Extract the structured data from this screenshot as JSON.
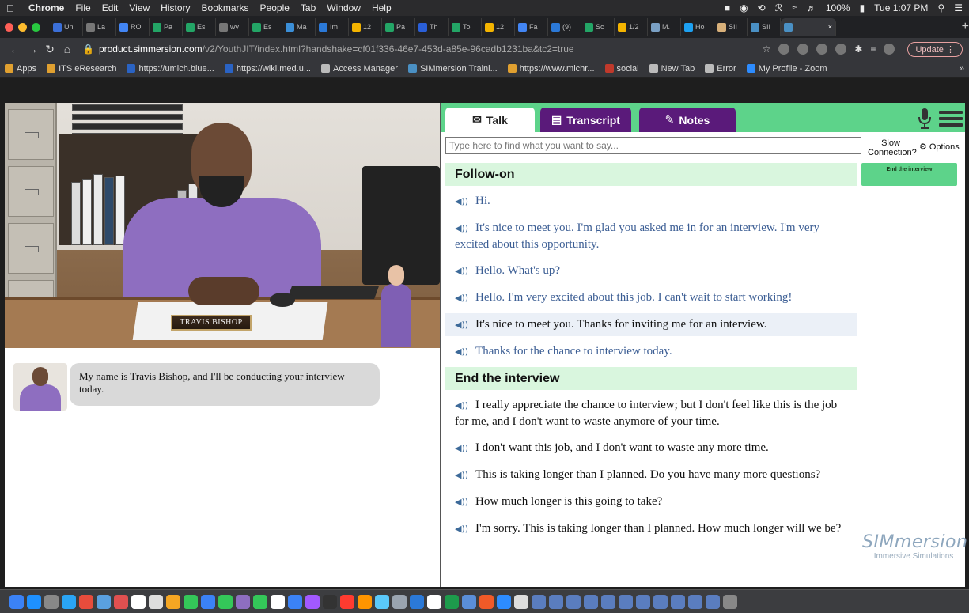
{
  "menubar": {
    "app": "Chrome",
    "items": [
      "File",
      "Edit",
      "View",
      "History",
      "Bookmarks",
      "People",
      "Tab",
      "Window",
      "Help"
    ],
    "battery": "100%",
    "clock": "Tue 1:07 PM"
  },
  "tabs": [
    {
      "label": "Un",
      "color": "#3b6fd8"
    },
    {
      "label": "La",
      "color": "#777777"
    },
    {
      "label": "RO",
      "color": "#4285f4"
    },
    {
      "label": "Pa",
      "color": "#23a566"
    },
    {
      "label": "Es",
      "color": "#23a566"
    },
    {
      "label": "wv",
      "color": "#777777"
    },
    {
      "label": "Es",
      "color": "#23a566"
    },
    {
      "label": "Ma",
      "color": "#3b8fd8"
    },
    {
      "label": "Im",
      "color": "#2b79d8"
    },
    {
      "label": "12",
      "color": "#f4b400"
    },
    {
      "label": "Pa",
      "color": "#23a566"
    },
    {
      "label": "Th",
      "color": "#2a5fd8"
    },
    {
      "label": "To",
      "color": "#23a566"
    },
    {
      "label": "12",
      "color": "#f4b400"
    },
    {
      "label": "Fa",
      "color": "#4285f4"
    },
    {
      "label": "(9)",
      "color": "#2b79d8"
    },
    {
      "label": "Sc",
      "color": "#23a566"
    },
    {
      "label": "1/2",
      "color": "#f4b400"
    },
    {
      "label": "M.",
      "color": "#7aa0c4"
    },
    {
      "label": "Ho",
      "color": "#1da1f2"
    },
    {
      "label": "SII",
      "color": "#d8b07a"
    },
    {
      "label": "SII",
      "color": "#4a90c4"
    },
    {
      "label": "",
      "color": "#4a90c4",
      "active": true
    }
  ],
  "address": {
    "host": "product.simmersion.com",
    "path": "/v2/YouthJIT/index.html?handshake=cf01f336-46e7-453d-a85e-96cadb1231ba&tc2=true",
    "update_label": "Update"
  },
  "bookmarks": [
    {
      "label": "Apps",
      "color": "#e0a030"
    },
    {
      "label": "ITS eResearch",
      "color": "#e0a030"
    },
    {
      "label": "https://umich.blue...",
      "color": "#2a63c4"
    },
    {
      "label": "https://wiki.med.u...",
      "color": "#2a63c4"
    },
    {
      "label": "Access Manager",
      "color": "#bbbbbb"
    },
    {
      "label": "SIMmersion Traini...",
      "color": "#4a90c4"
    },
    {
      "label": "https://www.michr...",
      "color": "#e0a030"
    },
    {
      "label": "social",
      "color": "#c0392b"
    },
    {
      "label": "New Tab",
      "color": "#bbbbbb"
    },
    {
      "label": "Error",
      "color": "#bbbbbb"
    },
    {
      "label": "My Profile - Zoom",
      "color": "#2d8cff"
    }
  ],
  "scene": {
    "nameplate": "TRAVIS BISHOP"
  },
  "chat": {
    "message": "My name is Travis Bishop, and I'll be conducting your interview today."
  },
  "panel": {
    "tabs": {
      "talk": "Talk",
      "transcript": "Transcript",
      "notes": "Notes"
    },
    "search_placeholder": "Type here to find what you want to say...",
    "slow_connection": "Slow Connection?",
    "options_label": "Options",
    "end_button": "End the interview",
    "sections": [
      {
        "title": "Follow-on",
        "options": [
          {
            "text": "Hi.",
            "style": "blue"
          },
          {
            "text": "It's nice to meet you. I'm glad you asked me in for an interview. I'm very excited about this opportunity.",
            "style": "blue"
          },
          {
            "text": "Hello. What's up?",
            "style": "blue"
          },
          {
            "text": "Hello. I'm very excited about this job. I can't wait to start working!",
            "style": "blue"
          },
          {
            "text": "It's nice to meet you. Thanks for inviting me for an interview.",
            "style": "black hl"
          },
          {
            "text": "Thanks for the chance to interview today.",
            "style": "blue"
          }
        ]
      },
      {
        "title": "End the interview",
        "options": [
          {
            "text": "I really appreciate the chance to interview; but I don't feel like this is the job for me, and I don't want to waste anymore of your time.",
            "style": "black"
          },
          {
            "text": "I don't want this job, and I don't want to waste any more time.",
            "style": "black"
          },
          {
            "text": "This is taking longer than I planned. Do you have many more questions?",
            "style": "black"
          },
          {
            "text": "How much longer is this going to take?",
            "style": "black"
          },
          {
            "text": "I'm sorry. This is taking longer than I planned. How much longer will we be?",
            "style": "black"
          }
        ]
      }
    ],
    "logo": {
      "name": "SIMmersion",
      "tagline": "Immersive Simulations"
    }
  },
  "dock": [
    "#3b82f6",
    "#1e90ff",
    "#888888",
    "#2aa4f4",
    "#e74c3c",
    "#5aa0e0",
    "#e05050",
    "#ffffff",
    "#dddddd",
    "#f5a623",
    "#34c759",
    "#3b82f6",
    "#34c759",
    "#8e6ec0",
    "#34c759",
    "#ffffff",
    "#3b82f6",
    "#a259ff",
    "#333333",
    "#ff3b30",
    "#ff9500",
    "#5ac8fa",
    "#9aa4b0",
    "#2b79d8",
    "#ffffff",
    "#1d9b4c",
    "#5a8ed8",
    "#f05a28",
    "#2d8cff",
    "#dddddd",
    "#5a7dbf",
    "#5a7dbf",
    "#5a7dbf",
    "#5a7dbf",
    "#5a7dbf",
    "#5a7dbf",
    "#5a7dbf",
    "#5a7dbf",
    "#5a7dbf",
    "#5a7dbf",
    "#5a7dbf",
    "#888888"
  ]
}
